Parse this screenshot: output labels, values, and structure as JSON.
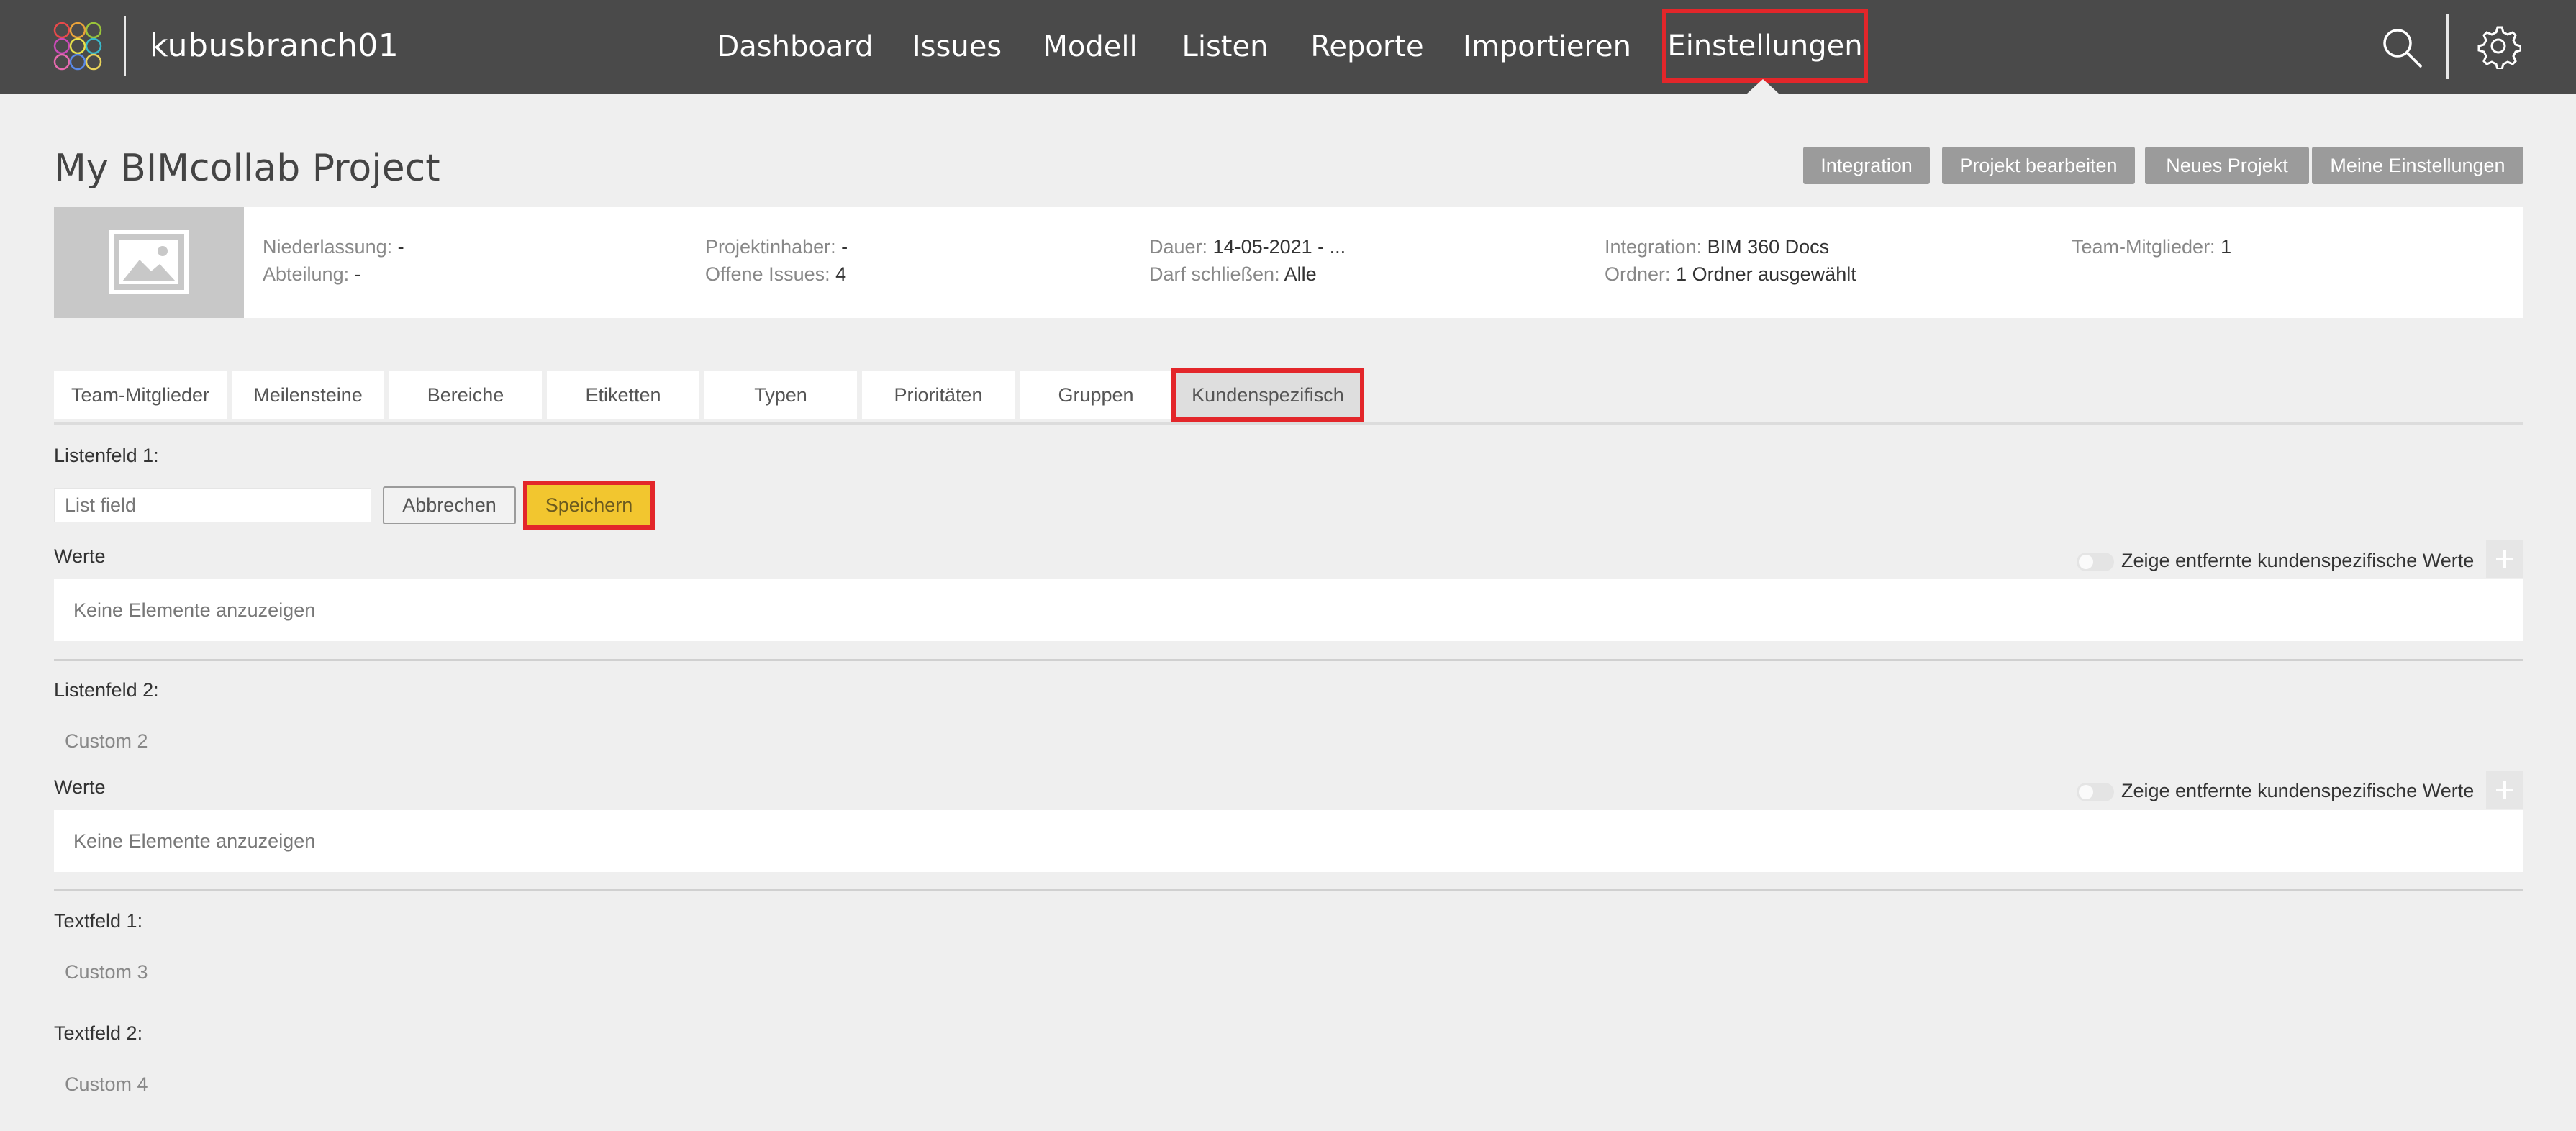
{
  "app": {
    "project_name": "kubusbranch01"
  },
  "nav": {
    "items": [
      "Dashboard",
      "Issues",
      "Modell",
      "Listen",
      "Reporte",
      "Importieren",
      "Einstellungen"
    ],
    "active": "Einstellungen"
  },
  "icons": {
    "search": "search-icon",
    "settings": "gear-icon",
    "logo": "logo-icon",
    "image_placeholder": "image-placeholder-icon",
    "add": "plus-icon"
  },
  "colors": {
    "topbar": "#4a4a4a",
    "highlight": "#e3262a",
    "save_button": "#f2c62f",
    "header_button": "#9b9b9b"
  },
  "header": {
    "title": "My BIMcollab Project",
    "buttons": [
      "Integration",
      "Projekt bearbeiten",
      "Neues Projekt",
      "Meine Einstellungen"
    ]
  },
  "info": {
    "niederlassung_label": "Niederlassung:",
    "niederlassung_value": "-",
    "abteilung_label": "Abteilung:",
    "abteilung_value": "-",
    "projektinhaber_label": "Projektinhaber:",
    "projektinhaber_value": "-",
    "offene_label": "Offene Issues:",
    "offene_value": "4",
    "dauer_label": "Dauer:",
    "dauer_value": "14-05-2021 - ...",
    "darf_label": "Darf schließen:",
    "darf_value": "Alle",
    "integration_label": "Integration:",
    "integration_value": "BIM 360 Docs",
    "ordner_label": "Ordner:",
    "ordner_value": "1 Ordner ausgewählt",
    "team_label": "Team-Mitglieder:",
    "team_value": "1"
  },
  "tabs": [
    "Team-Mitglieder",
    "Meilensteine",
    "Bereiche",
    "Etiketten",
    "Typen",
    "Prioritäten",
    "Gruppen",
    "Kundenspezifisch"
  ],
  "active_tab": "Kundenspezifisch",
  "custom": {
    "listenfeld1_label": "Listenfeld 1:",
    "listenfeld1_placeholder": "List field",
    "cancel_label": "Abbrechen",
    "save_label": "Speichern",
    "werte_label": "Werte",
    "toggle_label": "Zeige entfernte kundenspezifische Werte",
    "empty_text": "Keine Elemente anzuzeigen",
    "listenfeld2_label": "Listenfeld 2:",
    "listenfeld2_value": "Custom 2",
    "textfeld1_label": "Textfeld 1:",
    "textfeld1_value": "Custom 3",
    "textfeld2_label": "Textfeld 2:",
    "textfeld2_value": "Custom 4"
  }
}
